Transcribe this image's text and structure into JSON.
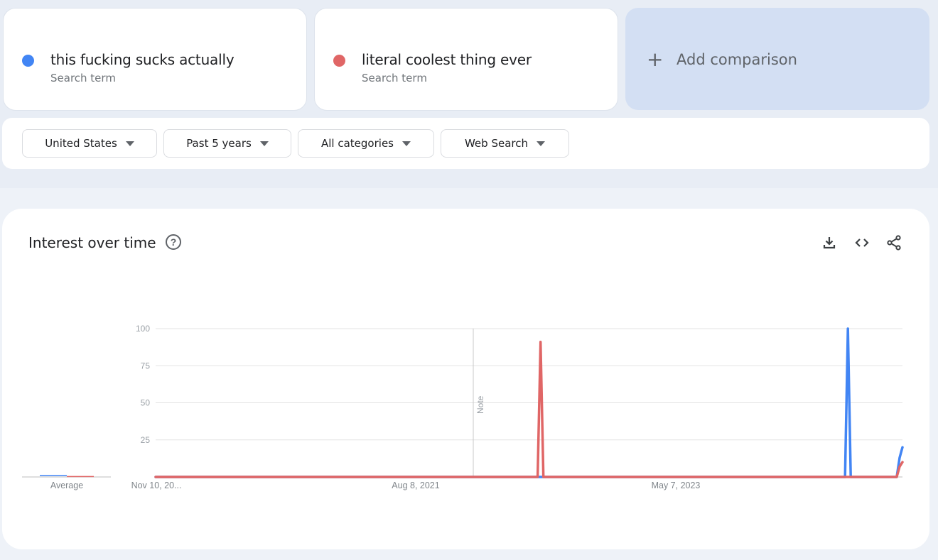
{
  "terms": [
    {
      "label": "this fucking sucks actually",
      "sublabel": "Search term",
      "color": "#4285f4"
    },
    {
      "label": "literal coolest thing ever",
      "sublabel": "Search term",
      "color": "#e06666"
    }
  ],
  "add_comparison": {
    "icon": "plus-icon",
    "label": "Add comparison"
  },
  "filters": [
    {
      "label": "United States",
      "icon": "caret-down-icon"
    },
    {
      "label": "Past 5 years",
      "icon": "caret-down-icon"
    },
    {
      "label": "All categories",
      "icon": "caret-down-icon"
    },
    {
      "label": "Web Search",
      "icon": "caret-down-icon"
    }
  ],
  "panel": {
    "title": "Interest over time",
    "help_icon": "help-circle-icon",
    "actions": [
      {
        "name": "download-icon"
      },
      {
        "name": "embed-code-icon"
      },
      {
        "name": "share-icon"
      }
    ]
  },
  "chart_data": {
    "type": "line",
    "title": "Interest over time",
    "xlabel": "",
    "ylabel": "",
    "ylim": [
      0,
      100
    ],
    "yticks": [
      25,
      50,
      75,
      100
    ],
    "x_tick_labels": [
      "Nov 10, 20...",
      "Aug 8, 2021",
      "May 7, 2023"
    ],
    "x_start": "Nov 10, 2019",
    "n_points": 261,
    "average_label": "Average",
    "averages": [
      {
        "name": "this fucking sucks actually",
        "value": 1
      },
      {
        "name": "literal coolest thing ever",
        "value": 0
      }
    ],
    "annotation": {
      "label": "Note",
      "at_index": 110
    },
    "grid": true,
    "legend": "none",
    "series": [
      {
        "name": "this fucking sucks actually",
        "color": "#4285f4",
        "baseline": 0,
        "points": [
          [
            240,
            0
          ],
          [
            241,
            100
          ],
          [
            242,
            0
          ],
          [
            258,
            0
          ],
          [
            259,
            13
          ],
          [
            260,
            20
          ]
        ]
      },
      {
        "name": "literal coolest thing ever",
        "color": "#e06666",
        "baseline": 0,
        "points": [
          [
            133,
            0
          ],
          [
            134,
            91
          ],
          [
            135,
            0
          ],
          [
            258,
            0
          ],
          [
            259,
            7
          ],
          [
            260,
            10
          ]
        ]
      }
    ]
  }
}
